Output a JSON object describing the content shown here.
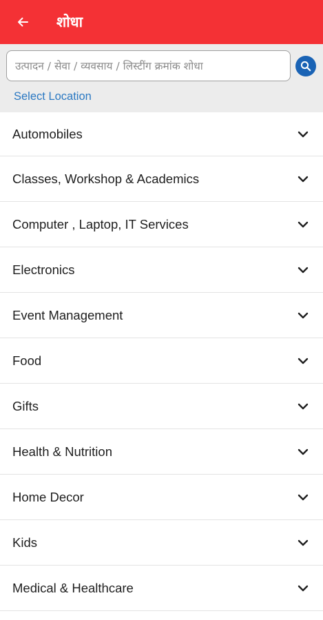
{
  "header": {
    "title": "शोधा",
    "back_icon": "arrow-left-icon",
    "color": "#f43135"
  },
  "search": {
    "placeholder": "उत्पादन / सेवा / व्यवसाय / लिस्टींग क्रमांक शोधा",
    "value": "",
    "button_icon": "search-icon",
    "button_color": "#1a63b5"
  },
  "location": {
    "label": "Select Location",
    "color": "#2a78c2"
  },
  "categories": [
    {
      "label": "Automobiles"
    },
    {
      "label": "Classes, Workshop & Academics"
    },
    {
      "label": "Computer , Laptop, IT Services"
    },
    {
      "label": "Electronics"
    },
    {
      "label": "Event Management"
    },
    {
      "label": "Food"
    },
    {
      "label": "Gifts"
    },
    {
      "label": "Health & Nutrition"
    },
    {
      "label": "Home Decor"
    },
    {
      "label": "Kids"
    },
    {
      "label": "Medical & Healthcare"
    }
  ],
  "category_icon": "chevron-down-icon"
}
